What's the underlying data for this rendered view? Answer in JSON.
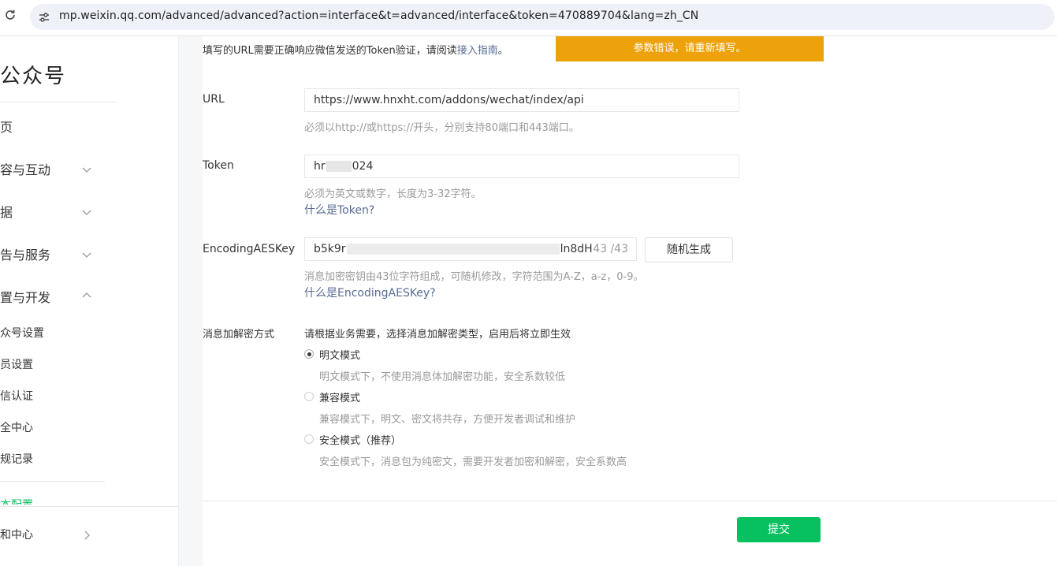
{
  "browser": {
    "url": "mp.weixin.qq.com/advanced/advanced?action=interface&t=advanced/interface&token=470889704&lang=zh_CN"
  },
  "sidebar": {
    "brand": "公众号",
    "items": [
      {
        "label": "页"
      },
      {
        "label": "容与互动"
      },
      {
        "label": "据"
      },
      {
        "label": "告与服务"
      },
      {
        "label": "置与开发"
      }
    ],
    "sub_items": [
      {
        "label": "众号设置"
      },
      {
        "label": "员设置"
      },
      {
        "label": "信认证"
      },
      {
        "label": "全中心"
      },
      {
        "label": "规记录"
      }
    ],
    "active_item": "本配置",
    "footer_item": "和中心"
  },
  "main": {
    "description_prefix": "填写的URL需要正确响应微信发送的Token验证，请阅读",
    "description_link": "接入指南",
    "description_suffix": "。",
    "error_banner": "参数错误，请重新填写。",
    "url_field": {
      "label": "URL",
      "value": "https://www.hnxht.com/addons/wechat/index/api",
      "hint": "必须以http://或https://开头，分别支持80端口和443端口。"
    },
    "token_field": {
      "label": "Token",
      "value_prefix": "hr",
      "value_suffix": "024",
      "hint": "必须为英文或数字，长度为3-32字符。",
      "link": "什么是Token?"
    },
    "aes_field": {
      "label": "EncodingAESKey",
      "value_prefix": "b5k9r",
      "value_suffix": "ln8dH",
      "counter": "43 /43",
      "generate_button": "随机生成",
      "hint": "消息加密密钥由43位字符组成，可随机修改，字符范围为A-Z，a-z，0-9。",
      "link": "什么是EncodingAESKey?"
    },
    "encryption": {
      "label": "消息加解密方式",
      "intro": "请根据业务需要，选择消息加解密类型，启用后将立即生效",
      "selected": "明文模式",
      "options": [
        {
          "label": "明文模式",
          "desc": "明文模式下，不使用消息体加解密功能，安全系数较低"
        },
        {
          "label": "兼容模式",
          "desc": "兼容模式下，明文、密文将共存，方便开发者调试和维护"
        },
        {
          "label": "安全模式（推荐）",
          "desc": "安全模式下，消息包为纯密文，需要开发者加密和解密，安全系数高"
        }
      ]
    },
    "submit_button": "提交"
  },
  "colors": {
    "primary": "#07c160",
    "warning": "#eda20b",
    "link": "#576b95"
  }
}
